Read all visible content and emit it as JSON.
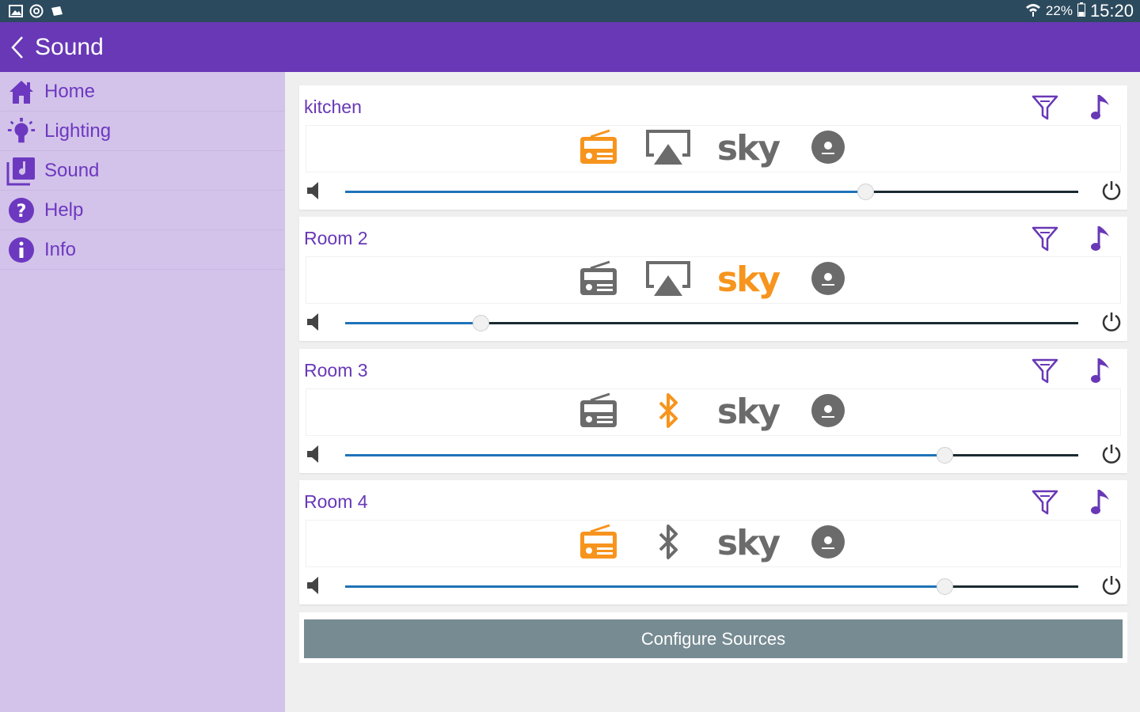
{
  "status_bar": {
    "icons_left": [
      "gallery-icon",
      "at-sign-icon",
      "photo-icon"
    ],
    "battery": "22%",
    "time": "15:20"
  },
  "appbar": {
    "title": "Sound"
  },
  "sidebar": {
    "items": [
      {
        "label": "Home",
        "icon": "home-icon"
      },
      {
        "label": "Lighting",
        "icon": "bulb-icon"
      },
      {
        "label": "Sound",
        "icon": "music-note-icon"
      },
      {
        "label": "Help",
        "icon": "question-icon"
      },
      {
        "label": "Info",
        "icon": "info-icon"
      }
    ]
  },
  "rooms": [
    {
      "name": "kitchen",
      "sources": [
        "radio",
        "airplay",
        "sky",
        "disc"
      ],
      "active_source": "radio",
      "volume_fraction": 0.71
    },
    {
      "name": "Room 2",
      "sources": [
        "radio",
        "airplay",
        "sky",
        "disc"
      ],
      "active_source": "sky",
      "volume_fraction": 0.185
    },
    {
      "name": "Room 3",
      "sources": [
        "radio",
        "bluetooth",
        "sky",
        "disc"
      ],
      "active_source": "bluetooth",
      "volume_fraction": 0.817
    },
    {
      "name": "Room 4",
      "sources": [
        "radio",
        "bluetooth",
        "sky",
        "disc"
      ],
      "active_source": "radio",
      "volume_fraction": 0.817
    }
  ],
  "sky_label": "sky",
  "config_button": "Configure Sources",
  "colors": {
    "accent": "#6838b6",
    "active_source": "#f7941d",
    "inactive_source": "#6b6b6b",
    "slider_fill": "#1f72b8",
    "sidebar_bg": "#d3c3ea",
    "status_bar": "#2c4a5e"
  }
}
